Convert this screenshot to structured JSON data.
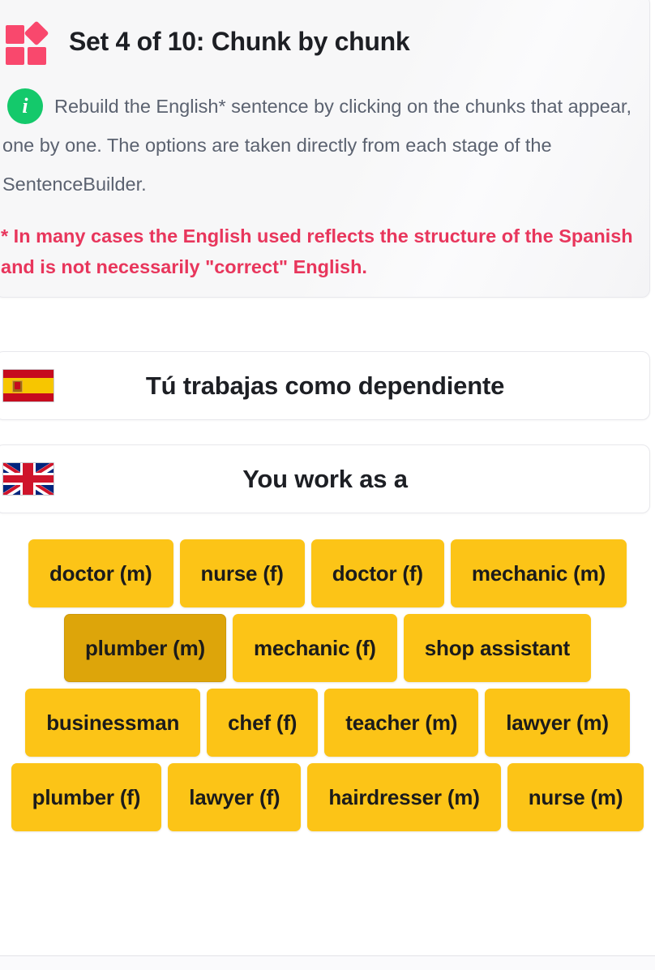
{
  "header": {
    "icon": "four-blocks-icon",
    "title": "Set 4 of 10: Chunk by chunk"
  },
  "instructions": {
    "icon": "info-icon",
    "text": "Rebuild the English* sentence by clicking on the chunks that appear, one by one. The options are taken directly from each stage of the SentenceBuilder.",
    "disclaimer": "* In many cases the English used reflects the structure of the Spanish and is not necessarily \"correct\" English."
  },
  "sentences": {
    "source": {
      "flag": "spain-flag-icon",
      "language": "Spanish",
      "text": "Tú trabajas como dependiente"
    },
    "target": {
      "flag": "uk-flag-icon",
      "language": "English",
      "text": "You work as a"
    }
  },
  "chunks": [
    {
      "label": "doctor (m)",
      "active": false
    },
    {
      "label": "nurse (f)",
      "active": false
    },
    {
      "label": "doctor (f)",
      "active": false
    },
    {
      "label": "mechanic (m)",
      "active": false
    },
    {
      "label": "plumber (m)",
      "active": true
    },
    {
      "label": "mechanic (f)",
      "active": false
    },
    {
      "label": "shop assistant",
      "active": false
    },
    {
      "label": "businessman",
      "active": false
    },
    {
      "label": "chef (f)",
      "active": false
    },
    {
      "label": "teacher (m)",
      "active": false
    },
    {
      "label": "lawyer (m)",
      "active": false
    },
    {
      "label": "plumber (f)",
      "active": false
    },
    {
      "label": "lawyer (f)",
      "active": false
    },
    {
      "label": "hairdresser (m)",
      "active": false
    },
    {
      "label": "nurse (m)",
      "active": false
    }
  ],
  "colors": {
    "accent_pink": "#f9486d",
    "info_green": "#14c96b",
    "disclaimer_red": "#e8365c",
    "chunk_yellow": "#fcc417",
    "chunk_yellow_active": "#dda50a",
    "card_bg": "#f7f7f8",
    "text_dark": "#1d1f24",
    "text_muted": "#5b6270"
  }
}
